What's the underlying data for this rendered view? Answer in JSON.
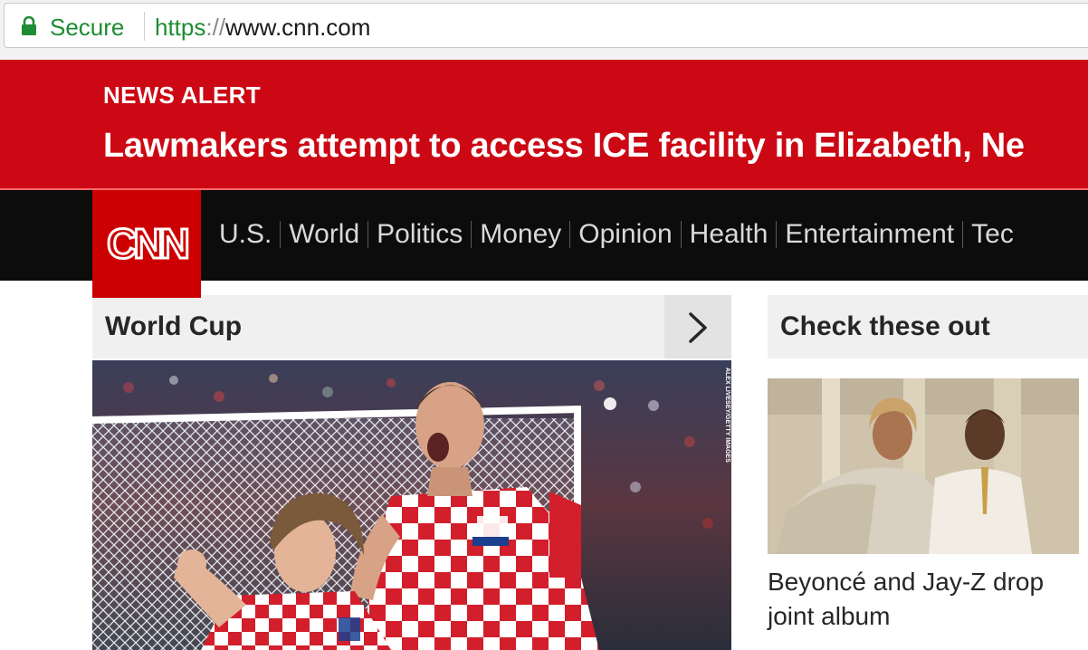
{
  "browser": {
    "secure_label": "Secure",
    "url_scheme": "https",
    "url_separator": "://",
    "url_host": "www.cnn.com"
  },
  "news_alert": {
    "label": "NEWS ALERT",
    "headline": "Lawmakers attempt to access ICE facility in Elizabeth, Ne"
  },
  "nav": {
    "logo_text": "CNN",
    "items": [
      {
        "label": "U.S."
      },
      {
        "label": "World"
      },
      {
        "label": "Politics"
      },
      {
        "label": "Money"
      },
      {
        "label": "Opinion"
      },
      {
        "label": "Health"
      },
      {
        "label": "Entertainment"
      },
      {
        "label": "Tec"
      }
    ]
  },
  "world_cup": {
    "title": "World Cup",
    "next_icon": "chevron-right-icon",
    "photo_credit": "ALEX LIVESEY/GETTY IMAGES"
  },
  "check_these_out": {
    "title": "Check these out",
    "story": {
      "caption": "Beyoncé and Jay-Z drop joint album"
    }
  },
  "colors": {
    "alert_red": "#cc0814",
    "logo_red": "#cc0000",
    "nav_black": "#0c0c0c",
    "secure_green": "#1e8c33"
  }
}
